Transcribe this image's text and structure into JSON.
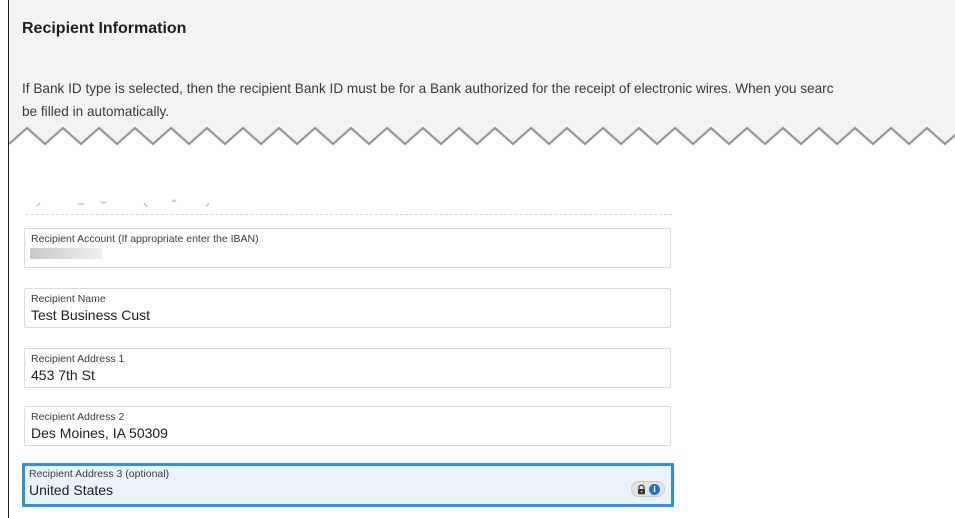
{
  "section": {
    "title": "Recipient Information",
    "description_line1": "If Bank ID type is selected, then the recipient Bank ID must be for a Bank authorized for the receipt of electronic wires. When you searc",
    "description_line2": "be filled in automatically."
  },
  "fields": [
    {
      "label": "Recipient Account (If appropriate enter the IBAN)",
      "value": ""
    },
    {
      "label": "Recipient Name",
      "value": "Test Business Cust"
    },
    {
      "label": "Recipient Address 1",
      "value": "453 7th St"
    },
    {
      "label": "Recipient Address 2",
      "value": "Des Moines, IA 50309"
    },
    {
      "label": "Recipient Address 3 (optional)",
      "value": "United States",
      "focused": true
    }
  ],
  "colors": {
    "focus_border": "#2f8fe0",
    "focus_background": "#eaf3fc",
    "header_background": "#f3f3f3"
  },
  "icons": {
    "password_manager": [
      "lock-icon",
      "info-icon"
    ]
  }
}
